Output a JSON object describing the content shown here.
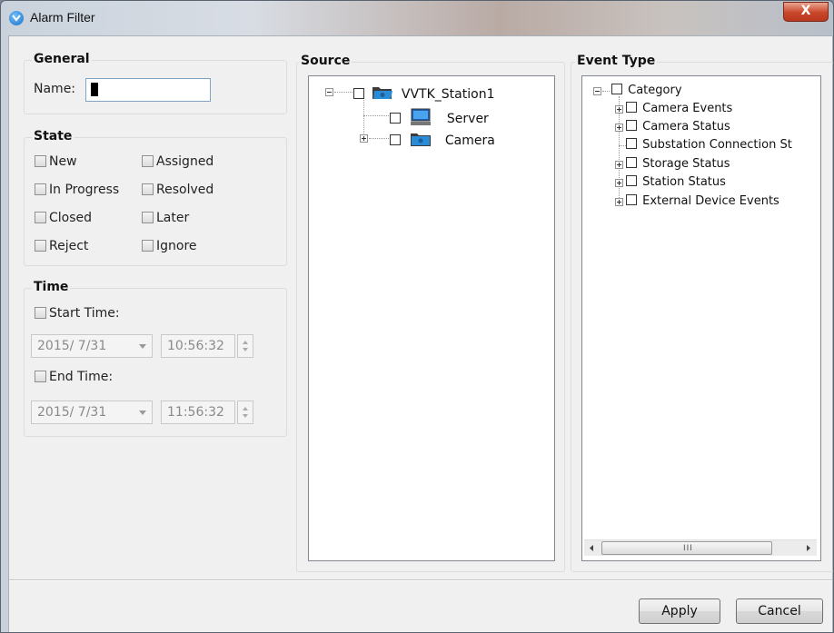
{
  "window": {
    "title": "Alarm Filter",
    "close_label": "X"
  },
  "general": {
    "legend": "General",
    "name_label": "Name:",
    "name_value": ""
  },
  "state": {
    "legend": "State",
    "options": [
      "New",
      "Assigned",
      "In Progress",
      "Resolved",
      "Closed",
      "Later",
      "Reject",
      "Ignore"
    ]
  },
  "time": {
    "legend": "Time",
    "start_label": "Start Time:",
    "start_date": "2015/ 7/31",
    "start_time": "10:56:32",
    "end_label": "End Time:",
    "end_date": "2015/ 7/31",
    "end_time": "11:56:32"
  },
  "source": {
    "legend": "Source",
    "root": "VVTK_Station1",
    "children": [
      "Server",
      "Camera"
    ]
  },
  "event_type": {
    "legend": "Event Type",
    "root": "Category",
    "children": [
      "Camera Events",
      "Camera Status",
      "Substation Connection St",
      "Storage Status",
      "Station Status",
      "External Device Events"
    ],
    "scroll_grip": "III"
  },
  "buttons": {
    "apply": "Apply",
    "cancel": "Cancel"
  }
}
